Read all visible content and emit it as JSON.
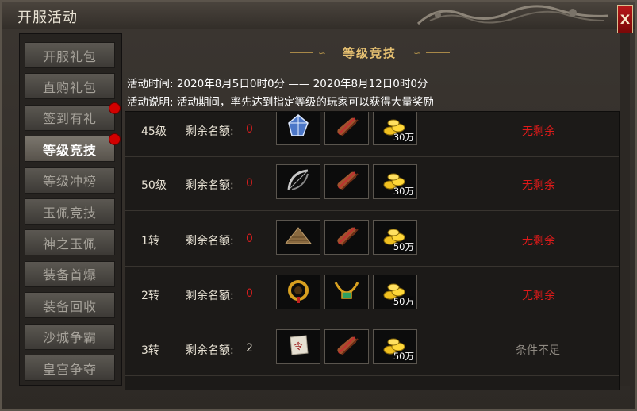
{
  "window": {
    "title": "开服活动",
    "close_label": "X"
  },
  "sidebar": {
    "items": [
      {
        "label": "开服礼包",
        "active": false,
        "dot": false
      },
      {
        "label": "直购礼包",
        "active": false,
        "dot": false
      },
      {
        "label": "签到有礼",
        "active": false,
        "dot": true
      },
      {
        "label": "等级竞技",
        "active": true,
        "dot": true
      },
      {
        "label": "等级冲榜",
        "active": false,
        "dot": false
      },
      {
        "label": "玉佩竞技",
        "active": false,
        "dot": false
      },
      {
        "label": "神之玉佩",
        "active": false,
        "dot": false
      },
      {
        "label": "装备首爆",
        "active": false,
        "dot": false
      },
      {
        "label": "装备回收",
        "active": false,
        "dot": false
      },
      {
        "label": "沙城争霸",
        "active": false,
        "dot": false
      },
      {
        "label": "皇宫争夺",
        "active": false,
        "dot": false
      }
    ]
  },
  "main": {
    "heading": "等级竞技",
    "time_line": "活动时间: 2020年8月5日0时0分   ——   2020年8月12日0时0分",
    "desc_line": "活动说明: 活动期间，率先达到指定等级的玩家可以获得大量奖励",
    "quota_label": "剩余名额:",
    "rows": [
      {
        "level": "45级",
        "quota": "0",
        "items": [
          {
            "icon": "blue-crystal-icon",
            "qty": ""
          },
          {
            "icon": "scroll-icon",
            "qty": ""
          },
          {
            "icon": "gold-coins-icon",
            "qty": "30万"
          }
        ],
        "status": "无剩余"
      },
      {
        "level": "50级",
        "quota": "0",
        "items": [
          {
            "icon": "bow-icon",
            "qty": ""
          },
          {
            "icon": "scroll-icon",
            "qty": ""
          },
          {
            "icon": "gold-coins-icon",
            "qty": "30万"
          }
        ],
        "status": "无剩余"
      },
      {
        "level": "1转",
        "quota": "0",
        "items": [
          {
            "icon": "straw-hat-icon",
            "qty": ""
          },
          {
            "icon": "scroll-icon",
            "qty": ""
          },
          {
            "icon": "gold-coins-icon",
            "qty": "50万"
          }
        ],
        "status": "无剩余"
      },
      {
        "level": "2转",
        "quota": "0",
        "items": [
          {
            "icon": "gold-ring-icon",
            "qty": ""
          },
          {
            "icon": "gold-necklace-icon",
            "qty": ""
          },
          {
            "icon": "gold-coins-icon",
            "qty": "50万"
          }
        ],
        "status": "无剩余"
      },
      {
        "level": "3转",
        "quota": "2",
        "items": [
          {
            "icon": "paper-note-icon",
            "qty": ""
          },
          {
            "icon": "scroll-icon",
            "qty": ""
          },
          {
            "icon": "gold-coins-icon",
            "qty": "50万"
          }
        ],
        "status": "条件不足"
      }
    ]
  },
  "colors": {
    "zero_quota": "#d81e1e",
    "normal_quota": "#e8e2d4",
    "status_none": "#e01a1a",
    "status_unmet": "#8f8a82"
  }
}
